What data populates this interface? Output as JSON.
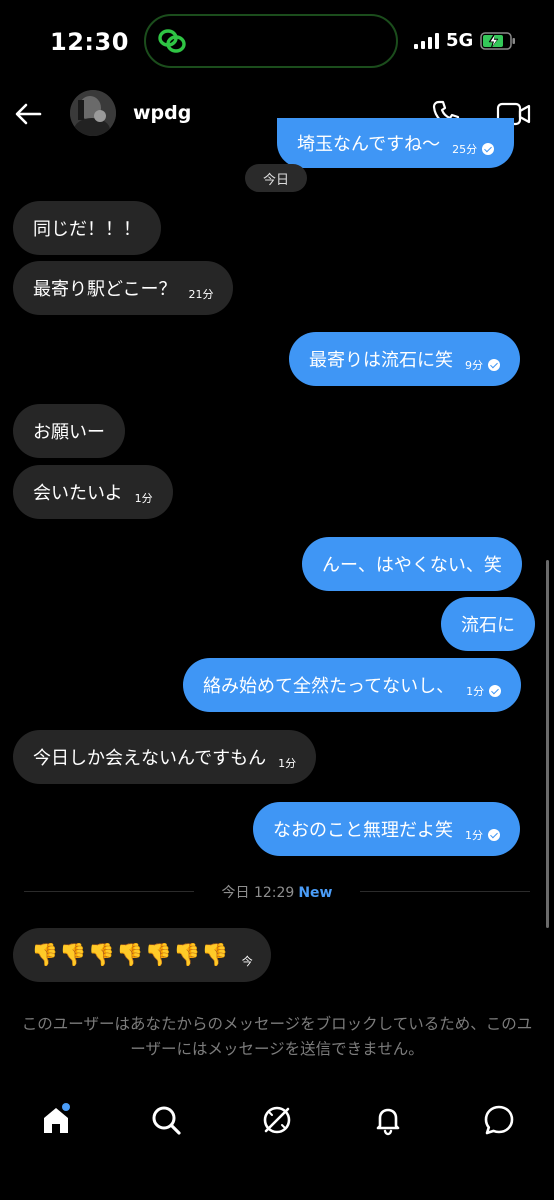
{
  "status_bar": {
    "time": "12:30",
    "network": "5G"
  },
  "header": {
    "username": "wpdg"
  },
  "chat": {
    "partial_top_message": {
      "text": "埼玉なんですね〜",
      "time": "25分"
    },
    "date_chip": "今日",
    "messages": [
      {
        "dir": "in",
        "text": "同じだ！！！",
        "time": ""
      },
      {
        "dir": "in",
        "text": "最寄り駅どこー？",
        "time": "21分"
      },
      {
        "dir": "out",
        "text": "最寄りは流石に笑",
        "time": "9分"
      },
      {
        "dir": "in",
        "text": "お願いー",
        "time": ""
      },
      {
        "dir": "in",
        "text": "会いたいよ",
        "time": "1分"
      },
      {
        "dir": "out",
        "text": "んー、はやくない、笑",
        "time": ""
      },
      {
        "dir": "out",
        "text": "流石に",
        "time": ""
      },
      {
        "dir": "out",
        "text": "絡み始めて全然たってないし、",
        "time": "1分"
      },
      {
        "dir": "in",
        "text": "今日しか会えないんですもん",
        "time": "1分"
      },
      {
        "dir": "out",
        "text": "なおのこと無理だよ笑",
        "time": "1分"
      }
    ],
    "divider": {
      "label": "今日 12:29",
      "badge": "New"
    },
    "last_message": {
      "text": "👎👎👎👎👎👎👎",
      "time": "今"
    }
  },
  "blocked_notice": "このユーザーはあなたからのメッセージをブロックしているため、このユーザーにはメッセージを送信できません。",
  "nav": {
    "items": [
      "home-icon",
      "search-icon",
      "explore-icon",
      "notifications-icon",
      "messages-icon"
    ]
  },
  "colors": {
    "outgoing": "#3f96f5",
    "incoming": "#262626",
    "accent": "#4b9df8"
  }
}
